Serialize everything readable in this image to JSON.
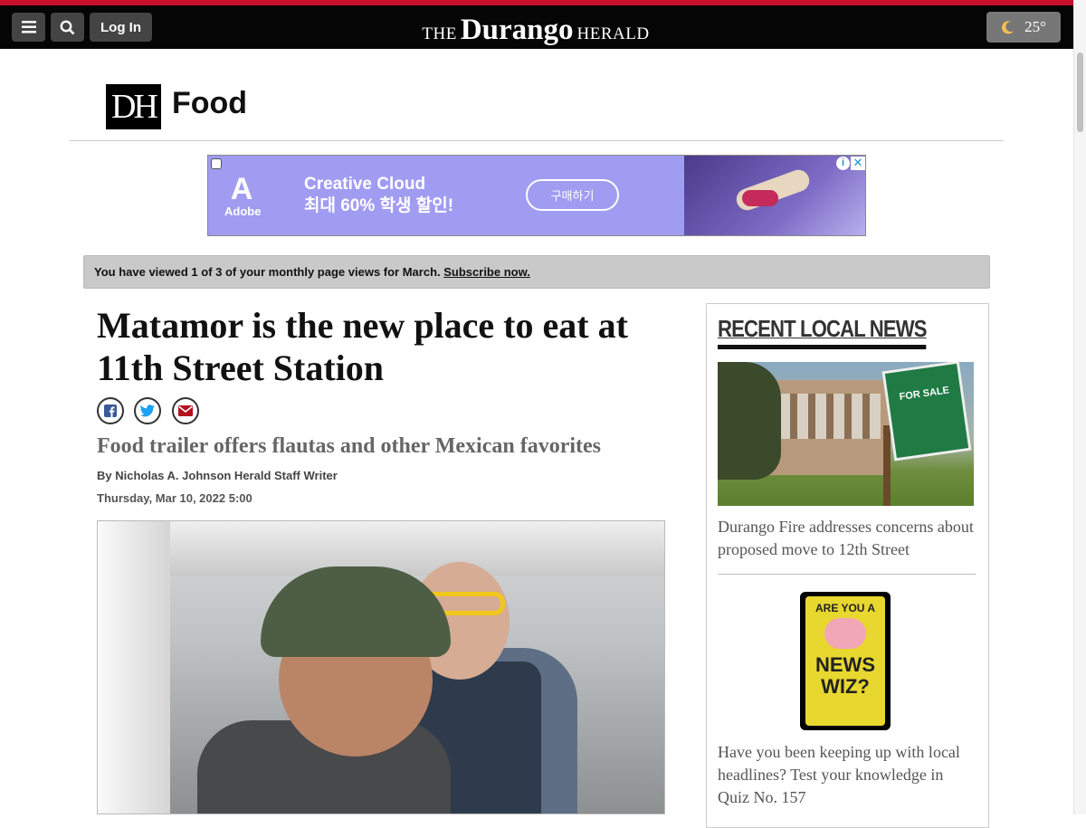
{
  "topbar": {
    "login_label": "Log In",
    "masthead_the": "THE",
    "masthead_durango": "Durango",
    "masthead_herald": "HERALD",
    "weather_temp": "25°",
    "menu_icon": "hamburger-menu-icon",
    "search_icon": "search-icon",
    "weather_icon": "moon-icon",
    "accent_color": "#c8102e"
  },
  "section": {
    "logo_text": "DH",
    "title": "Food"
  },
  "ad": {
    "brand": "Adobe",
    "line1": "Creative Cloud",
    "line2": "최대 60% 학생 할인!",
    "cta": "구매하기",
    "background_color": "#a09cf2"
  },
  "meter": {
    "text": "You have viewed 1 of 3 of your monthly page views for March.",
    "link": "Subscribe now."
  },
  "article": {
    "headline": "Matamor is the new place to eat at 11th Street Station",
    "subhead": "Food trailer offers flautas and other Mexican favorites",
    "byline": "By Nicholas A. Johnson Herald Staff Writer",
    "date": "Thursday, Mar 10, 2022 5:00",
    "share_icons": [
      "facebook-icon",
      "twitter-icon",
      "email-icon"
    ]
  },
  "sidebar": {
    "title": "RECENT LOCAL NEWS",
    "story1": {
      "sign_text": "FOR SALE",
      "headline": "Durango Fire addresses concerns about proposed move to 12th Street"
    },
    "story2": {
      "badge_top": "ARE YOU A",
      "badge_bottom": "NEWS WIZ?",
      "headline": "Have you been keeping up with local headlines? Test your knowledge in Quiz No. 157"
    }
  }
}
